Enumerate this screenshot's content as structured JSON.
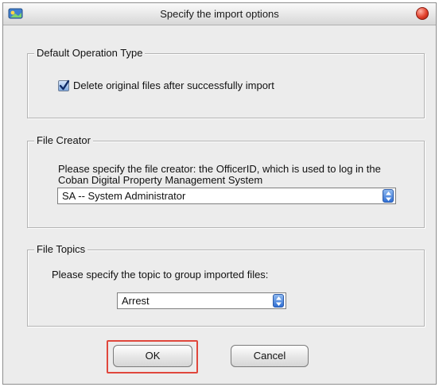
{
  "window": {
    "title": "Specify the import options"
  },
  "operation_group": {
    "legend": "Default Operation Type",
    "delete_checkbox": {
      "label": "Delete original files after successfully import",
      "checked": true
    }
  },
  "creator_group": {
    "legend": "File Creator",
    "instruction": "Please specify the file creator: the OfficerID, which is used to log in the Coban Digital Property Management System",
    "selected": "SA -- System Administrator"
  },
  "topics_group": {
    "legend": "File Topics",
    "instruction": "Please specify the topic to group imported files:",
    "selected": "Arrest"
  },
  "buttons": {
    "ok_label": "OK",
    "cancel_label": "Cancel"
  },
  "colors": {
    "highlight": "#e0473c",
    "select_arrow": "#2f6fd4"
  }
}
